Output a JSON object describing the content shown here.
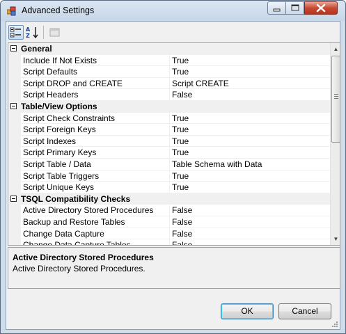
{
  "window": {
    "title": "Advanced Settings",
    "close_symbol": "x"
  },
  "toolbar": {
    "categorized_icon": "categorized-view-icon",
    "alphabetical_icon": "sort-alphabetical-icon",
    "pages_icon": "property-pages-icon"
  },
  "grid": {
    "categories": [
      {
        "label": "General",
        "properties": [
          {
            "name": "Include If Not Exists",
            "value": "True"
          },
          {
            "name": "Script Defaults",
            "value": "True"
          },
          {
            "name": "Script DROP and CREATE",
            "value": "Script CREATE"
          },
          {
            "name": "Script Headers",
            "value": "False"
          }
        ]
      },
      {
        "label": "Table/View Options",
        "properties": [
          {
            "name": "Script Check Constraints",
            "value": "True"
          },
          {
            "name": "Script Foreign Keys",
            "value": "True"
          },
          {
            "name": "Script Indexes",
            "value": "True"
          },
          {
            "name": "Script Primary Keys",
            "value": "True"
          },
          {
            "name": "Script Table / Data",
            "value": "Table Schema with Data"
          },
          {
            "name": "Script Table Triggers",
            "value": "True"
          },
          {
            "name": "Script Unique Keys",
            "value": "True"
          }
        ]
      },
      {
        "label": "TSQL Compatibility Checks",
        "properties": [
          {
            "name": "Active Directory Stored Procedures",
            "value": "False"
          },
          {
            "name": "Backup and Restore Tables",
            "value": "False"
          },
          {
            "name": "Change Data Capture",
            "value": "False"
          },
          {
            "name": "Change Data Capture Tables",
            "value": "False"
          }
        ]
      }
    ]
  },
  "help": {
    "title": "Active Directory Stored Procedures",
    "description": "Active Directory Stored Procedures."
  },
  "buttons": {
    "ok": "OK",
    "cancel": "Cancel"
  },
  "colors": {
    "title_bar": "#c6d6e8",
    "close_button": "#c74a33",
    "default_button_border": "#3c7fb1"
  }
}
